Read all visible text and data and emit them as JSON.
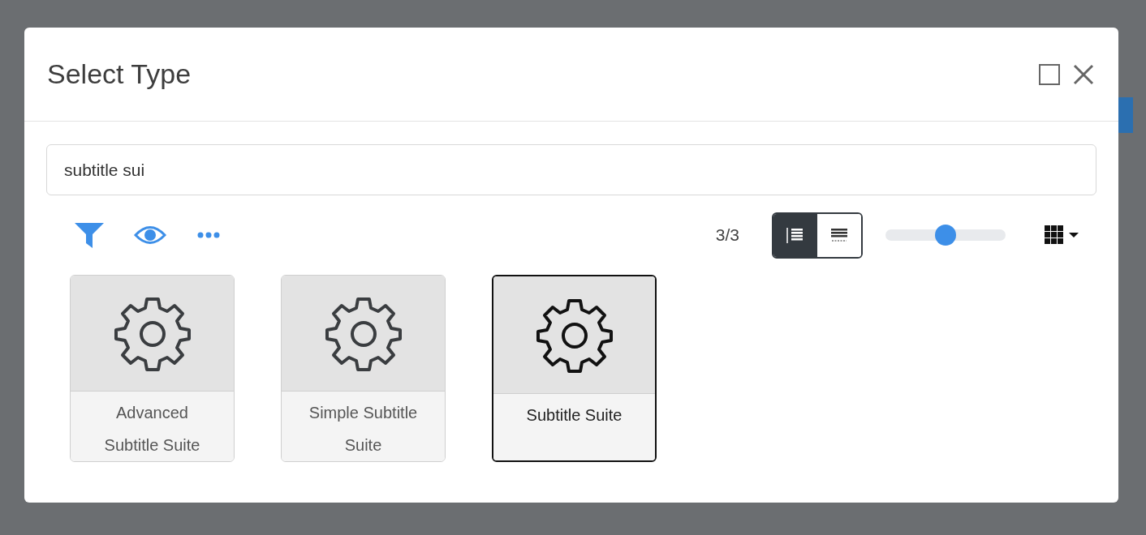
{
  "dialog": {
    "title": "Select Type"
  },
  "search": {
    "value": "subtitle sui"
  },
  "toolbar": {
    "count": "3/3",
    "view_modes": [
      {
        "kind": "list",
        "selected": true
      },
      {
        "kind": "compact",
        "selected": false
      }
    ],
    "size_slider": {
      "level": 0.5
    }
  },
  "items": [
    {
      "label": "Advanced Subtitle Suite",
      "selected": false
    },
    {
      "label": "Simple Subtitle Suite",
      "selected": false
    },
    {
      "label": "Subtitle Suite",
      "selected": true
    }
  ]
}
